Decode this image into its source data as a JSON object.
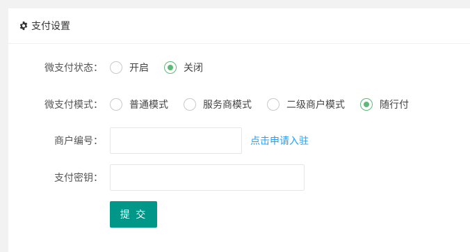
{
  "panel": {
    "icon": "gear-icon",
    "title": "支付设置"
  },
  "status": {
    "label": "微支付状态：",
    "options": [
      {
        "label": "开启",
        "checked": false
      },
      {
        "label": "关闭",
        "checked": true
      }
    ]
  },
  "mode": {
    "label": "微支付模式：",
    "options": [
      {
        "label": "普通模式",
        "checked": false
      },
      {
        "label": "服务商模式",
        "checked": false
      },
      {
        "label": "二级商户模式",
        "checked": false
      },
      {
        "label": "随行付",
        "checked": true
      }
    ]
  },
  "merchant": {
    "label": "商户编号：",
    "value": "",
    "link": "点击申请入驻"
  },
  "secret": {
    "label": "支付密钥：",
    "value": ""
  },
  "submit_label": "提 交",
  "colors": {
    "accent": "#009688",
    "radio_checked": "#5fb878",
    "link": "#1e9fff"
  }
}
